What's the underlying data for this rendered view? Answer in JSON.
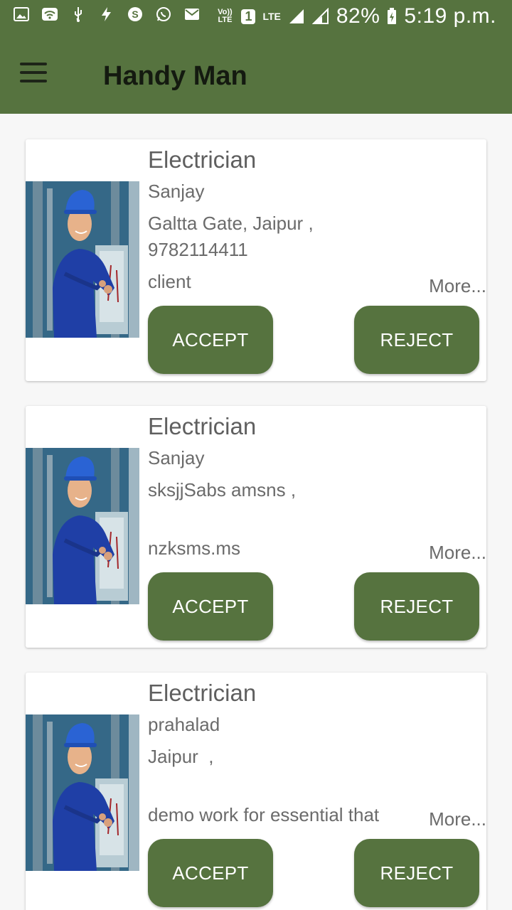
{
  "status_bar": {
    "icons": [
      "gallery-icon",
      "wifi-icon",
      "usb-icon",
      "flash-icon",
      "skype-icon",
      "whatsapp-icon",
      "mail-icon"
    ],
    "volte": "Vo)) LTE",
    "sim": "1",
    "network": "LTE",
    "battery": "82%",
    "time": "5:19 p.m."
  },
  "app_bar": {
    "title": "Handy Man"
  },
  "colors": {
    "primary": "#56733f",
    "card": "#ffffff",
    "text": "#6b6b6b"
  },
  "requests": [
    {
      "category": "Electrician",
      "name": "Sanjay",
      "address": "Galtta Gate, Jaipur ,",
      "phone": "9782114411",
      "description": "client",
      "more": "More...",
      "accept": "ACCEPT",
      "reject": "REJECT"
    },
    {
      "category": "Electrician",
      "name": "Sanjay",
      "address": "sksjjSabs amsns ,",
      "phone": "",
      "description": "nzksms.ms",
      "more": "More...",
      "accept": "ACCEPT",
      "reject": "REJECT"
    },
    {
      "category": "Electrician",
      "name": "prahalad",
      "address": "Jaipur  ,",
      "phone": "",
      "description": "demo work for essential that",
      "more": "More...",
      "accept": "ACCEPT",
      "reject": "REJECT"
    }
  ]
}
